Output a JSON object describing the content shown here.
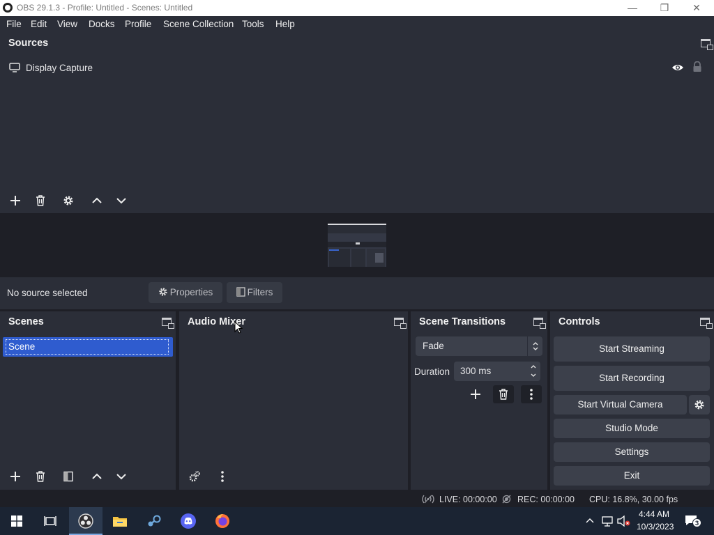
{
  "window": {
    "title": "OBS 29.1.3 - Profile: Untitled - Scenes: Untitled",
    "minimize": "—",
    "maximize": "❐",
    "close": "✕"
  },
  "menu": [
    "File",
    "Edit",
    "View",
    "Docks",
    "Profile",
    "Scene Collection",
    "Tools",
    "Help"
  ],
  "sources": {
    "title": "Sources",
    "items": [
      {
        "label": "Display Capture"
      }
    ]
  },
  "preview_bar": {
    "status": "No source selected",
    "properties": "Properties",
    "filters": "Filters"
  },
  "scenes": {
    "title": "Scenes",
    "items": [
      {
        "label": "Scene",
        "selected": true
      }
    ]
  },
  "audio_mixer": {
    "title": "Audio Mixer"
  },
  "transitions": {
    "title": "Scene Transitions",
    "selected": "Fade",
    "duration_label": "Duration",
    "duration_value": "300 ms"
  },
  "controls": {
    "title": "Controls",
    "start_streaming": "Start Streaming",
    "start_recording": "Start Recording",
    "start_virtual_camera": "Start Virtual Camera",
    "studio_mode": "Studio Mode",
    "settings": "Settings",
    "exit": "Exit"
  },
  "statusbar": {
    "live": "LIVE: 00:00:00",
    "rec": "REC: 00:00:00",
    "cpu": "CPU: 16.8%, 30.00 fps"
  },
  "taskbar": {
    "time": "4:44 AM",
    "date": "10/3/2023",
    "notifications": "3"
  },
  "colors": {
    "panel": "#2b2e38",
    "background": "#1e1f26",
    "button": "#3c404b",
    "selection": "#2f5ccf"
  }
}
